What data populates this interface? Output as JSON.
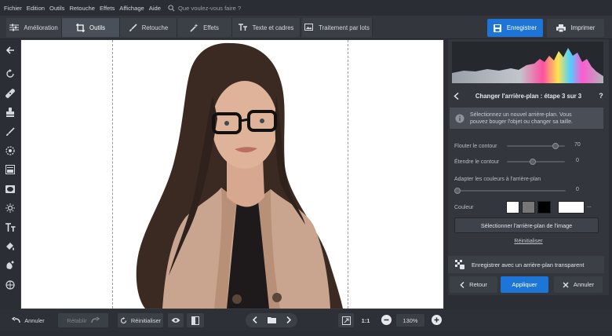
{
  "menu": {
    "items": [
      "Fichier",
      "Edition",
      "Outils",
      "Retouche",
      "Effets",
      "Affichage",
      "Aide"
    ],
    "search_placeholder": "Que voulez-vous faire ?"
  },
  "toolbar": {
    "tabs": [
      {
        "label": "Amélioration",
        "icon": "sliders-icon"
      },
      {
        "label": "Outils",
        "icon": "crop-icon",
        "active": true
      },
      {
        "label": "Retouche",
        "icon": "brush-icon"
      },
      {
        "label": "Effets",
        "icon": "magic-wand-icon"
      },
      {
        "label": "Texte et cadres",
        "icon": "text-icon"
      },
      {
        "label": "Traitement par lots",
        "icon": "images-icon"
      }
    ],
    "save_label": "Enregistrer",
    "print_label": "Imprimer"
  },
  "left_tools": [
    "back-arrow-icon",
    "rotate-icon",
    "heal-icon",
    "stamp-icon",
    "brush-icon",
    "radial-icon",
    "gradient-icon",
    "vignette-icon",
    "sun-icon",
    "text-icon",
    "fill-icon",
    "shape-icon",
    "globe-icon"
  ],
  "panel": {
    "step_title": "Changer l'arrière-plan : étape 3 sur 3",
    "help": "?",
    "info_line1": "Sélectionnez un nouvel arrière-plan. Vous",
    "info_line2": "pouvez bouger l'objet ou changer sa taille.",
    "blur_label": "Flouter le contour",
    "blur_value": "70",
    "blur_fraction": 0.84,
    "extend_label": "Étendre le contour",
    "extend_value": "0",
    "extend_fraction": 0.45,
    "adapt_label": "Adapter les couleurs à l'arrière-plan",
    "adapt_value": "0",
    "adapt_fraction": 0.0,
    "color_label": "Couleur",
    "swatches": [
      "#ffffff",
      "#777777",
      "#000000"
    ],
    "selected_color": "#ffffff",
    "more": "...",
    "select_image_label": "Sélectionner l'arrière-plan de l'image",
    "reset_link": "Réinitialiser",
    "save_transparent_label": "Enregistrer avec un arrière-plan transparent",
    "back_label": "Retour",
    "apply_label": "Appliquer",
    "cancel_label": "Annuler"
  },
  "bottom": {
    "undo_label": "Annuler",
    "redo_label": "Rétablir",
    "reset_label": "Réinitialiser",
    "zoom_ratio": "1:1",
    "zoom_value": "130%"
  },
  "colors": {
    "accent": "#1d75d8",
    "background": "#2b2e34",
    "panel": "#33363d"
  }
}
